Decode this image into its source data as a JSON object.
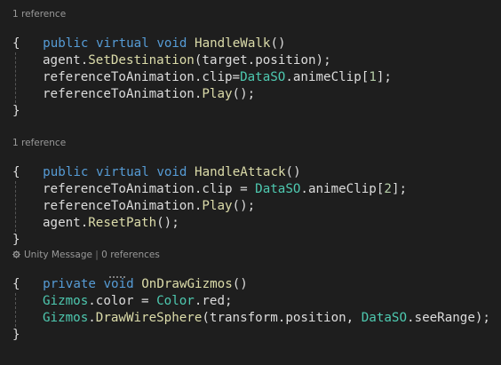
{
  "colors": {
    "background": "#1e1e1e",
    "keyword": "#569cd6",
    "method": "#dcdcaa",
    "type": "#4ec9b0",
    "number": "#b5cea8",
    "plain": "#dcdcdc",
    "codelens": "#999999"
  },
  "icons": {
    "codelens_unity": "unity-cog-icon"
  },
  "walk": {
    "codelens": "1 reference",
    "sig": {
      "k1": "public",
      "k2": "virtual",
      "k3": "void",
      "name": "HandleWalk",
      "paren": "()"
    },
    "open": "{",
    "l1": {
      "a": "agent",
      "d": ".",
      "m": "SetDestination",
      "rest": "(target.position);"
    },
    "l2": {
      "a": "referenceToAnimation.clip=",
      "t": "DataSO",
      "b": ".animeClip[",
      "n": "1",
      "c": "];"
    },
    "l3": {
      "a": "referenceToAnimation.",
      "m": "Play",
      "rest": "();"
    },
    "close": "}"
  },
  "attack": {
    "codelens": "1 reference",
    "sig": {
      "k1": "public",
      "k2": "virtual",
      "k3": "void",
      "name": "HandleAttack",
      "paren": "()"
    },
    "open": "{",
    "l1": {
      "a": "referenceToAnimation.clip = ",
      "t": "DataSO",
      "b": ".animeClip[",
      "n": "2",
      "c": "];"
    },
    "l2": {
      "a": "referenceToAnimation.",
      "m": "Play",
      "rest": "();"
    },
    "l3": {
      "a": "agent.",
      "m": "ResetPath",
      "rest": "();"
    },
    "close": "}"
  },
  "gizmos": {
    "codelens_a": "Unity Message",
    "codelens_sep": " | ",
    "codelens_b": "0 references",
    "sig": {
      "k1": "private",
      "k2": "void",
      "name": "OnDrawGizmos",
      "paren": "()"
    },
    "open": "{",
    "l1": {
      "t1": "Gizmos",
      "a": ".color = ",
      "t2": "Color",
      "b": ".red;"
    },
    "l2": {
      "t1": "Gizmos",
      "a": ".",
      "m": "DrawWireSphere",
      "b": "(transform.position, ",
      "t2": "DataSO",
      "c": ".seeRange);"
    },
    "close": "}"
  }
}
